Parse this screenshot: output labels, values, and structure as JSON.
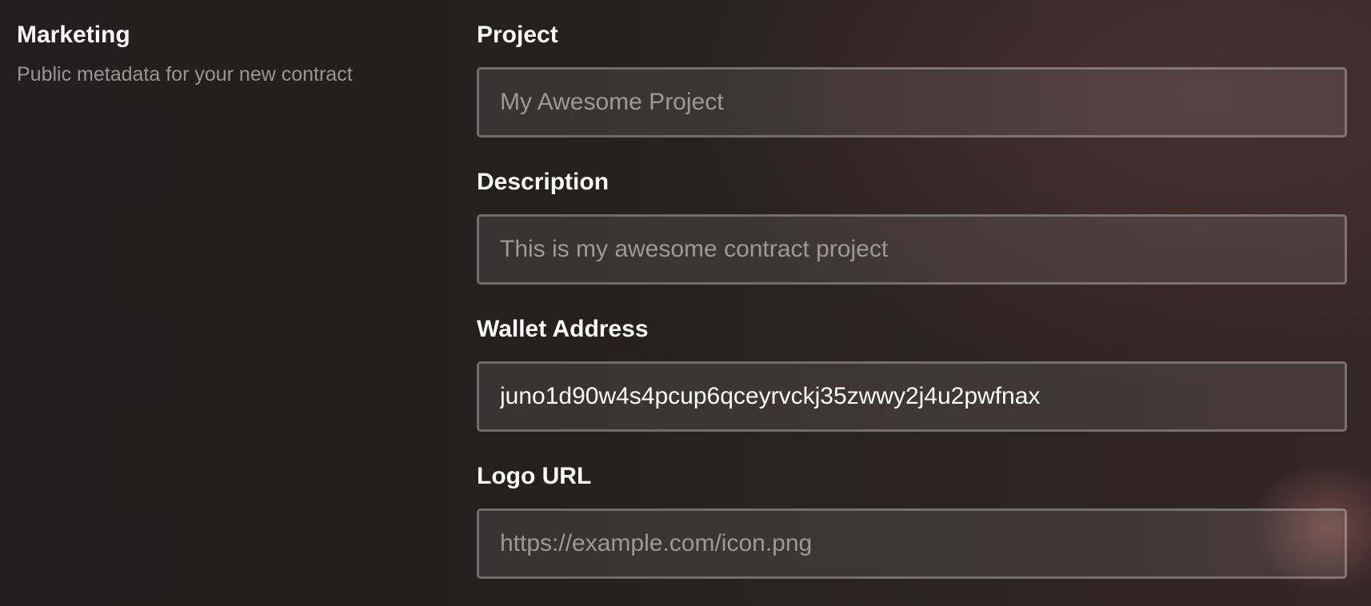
{
  "section": {
    "title": "Marketing",
    "subtitle": "Public metadata for your new contract"
  },
  "fields": [
    {
      "label": "Project",
      "value": "",
      "placeholder": "My Awesome Project"
    },
    {
      "label": "Description",
      "value": "",
      "placeholder": "This is my awesome contract project"
    },
    {
      "label": "Wallet Address",
      "value": "juno1d90w4s4pcup6qceyrvckj35zwwy2j4u2pwfnax",
      "placeholder": ""
    },
    {
      "label": "Logo URL",
      "value": "",
      "placeholder": "https://example.com/icon.png"
    }
  ]
}
